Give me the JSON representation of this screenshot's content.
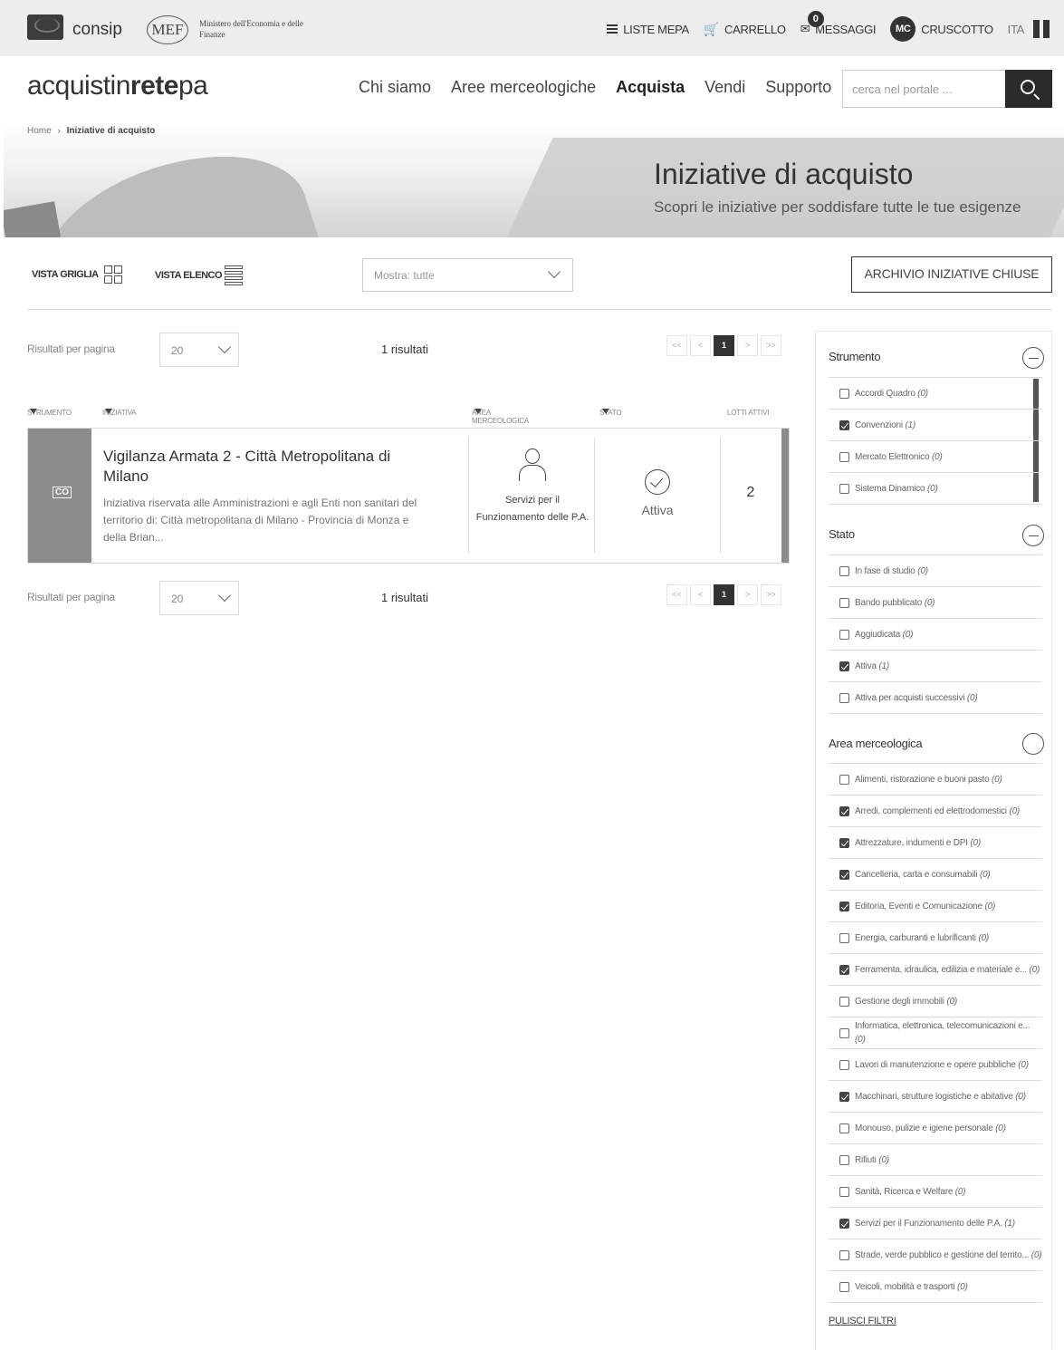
{
  "topbar": {
    "consip": "consip",
    "mef_logo": "MEF",
    "mef_text": "Ministero dell'Economia e delle Finanze",
    "liste_mepa": "LISTE MEPA",
    "carrello": "CARRELLO",
    "messaggi": "MESSAGGI",
    "messaggi_count": "0",
    "avatar": "MC",
    "cruscotto": "CRUSCOTTO",
    "lang": "ITA"
  },
  "header": {
    "brand_a": "acquistin",
    "brand_b": "rete",
    "brand_c": "pa",
    "nav": [
      "Chi siamo",
      "Aree merceologiche",
      "Acquista",
      "Vendi",
      "Supporto"
    ],
    "search_placeholder": "cerca nel portale ..."
  },
  "breadcrumb": {
    "home": "Home",
    "sep": "›",
    "current": "Iniziative di acquisto"
  },
  "hero": {
    "title": "Iniziative di acquisto",
    "subtitle": "Scopri le iniziative per soddisfare tutte le tue esigenze"
  },
  "toolbar": {
    "vista_griglia": "VISTA GRIGLIA",
    "vista_elenco": "VISTA ELENCO",
    "show_select": "Mostra: tutte",
    "archive": "ARCHIVIO INIZIATIVE CHIUSE"
  },
  "results": {
    "per_page_label": "Risultati per pagina",
    "per_page_value": "20",
    "count": "1 risultati",
    "pager": [
      "<<",
      "<",
      "1",
      ">",
      ">>"
    ]
  },
  "columns": {
    "strumento": "STRUMENTO",
    "iniziativa": "INIZIATIVA",
    "area": "AREA MERCEOLOGICA",
    "stato": "STATO",
    "lotti": "LOTTI ATTIVI"
  },
  "card": {
    "tag": "CO",
    "title": "Vigilanza Armata 2 - Città Metropolitana di Milano",
    "description": "Iniziativa riservata alle Amministrazioni e agli Enti non sanitari del territorio di: Città metropolitana di Milano - Provincia di Monza e della Brian...",
    "area": "Servizi per il Funzionamento delle P.A.",
    "status": "Attiva",
    "count": "2"
  },
  "filters": {
    "strumento": {
      "title": "Strumento",
      "options": [
        {
          "label": "Accordi Quadro",
          "count": "(0)",
          "checked": false
        },
        {
          "label": "Convenzioni",
          "count": "(1)",
          "checked": true
        },
        {
          "label": "Mercato Elettronico",
          "count": "(0)",
          "checked": false
        },
        {
          "label": "Sistema Dinamico",
          "count": "(0)",
          "checked": false
        }
      ]
    },
    "stato": {
      "title": "Stato",
      "options": [
        {
          "label": "In fase di studio",
          "count": "(0)",
          "checked": false
        },
        {
          "label": "Bando pubblicato",
          "count": "(0)",
          "checked": false
        },
        {
          "label": "Aggiudicata",
          "count": "(0)",
          "checked": false
        },
        {
          "label": "Attiva",
          "count": "(1)",
          "checked": true
        },
        {
          "label": "Attiva per acquisti successivi",
          "count": "(0)",
          "checked": false
        }
      ]
    },
    "area": {
      "title": "Area merceologica",
      "options": [
        {
          "label": "Alimenti, ristorazione e buoni pasto",
          "count": "(0)",
          "checked": false
        },
        {
          "label": "Arredi, complementi ed elettrodomestici",
          "count": "(0)",
          "checked": true
        },
        {
          "label": "Attrezzature, indumenti e DPI",
          "count": "(0)",
          "checked": true
        },
        {
          "label": "Cancelleria, carta e consumabili",
          "count": "(0)",
          "checked": true
        },
        {
          "label": "Editoria, Eventi e Comunicazione",
          "count": "(0)",
          "checked": true
        },
        {
          "label": "Energia, carburanti e lubrificanti",
          "count": "(0)",
          "checked": false
        },
        {
          "label": "Ferramenta, idraulica, edilizia e materiale e...",
          "count": "(0)",
          "checked": true
        },
        {
          "label": "Gestione degli immobili",
          "count": "(0)",
          "checked": false
        },
        {
          "label": "Informatica, elettronica, telecomunicazioni e...",
          "count": "(0)",
          "checked": false
        },
        {
          "label": "Lavori di manutenzione e opere pubbliche",
          "count": "(0)",
          "checked": false
        },
        {
          "label": "Macchinari, strutture logistiche e abitative",
          "count": "(0)",
          "checked": true
        },
        {
          "label": "Monouso, pulizie e igiene personale",
          "count": "(0)",
          "checked": false
        },
        {
          "label": "Rifiuti",
          "count": "(0)",
          "checked": false
        },
        {
          "label": "Sanità, Ricerca e Welfare",
          "count": "(0)",
          "checked": false
        },
        {
          "label": "Servizi per il Funzionamento delle P.A.",
          "count": "(1)",
          "checked": true
        },
        {
          "label": "Strade, verde pubblico e gestione del territo...",
          "count": "(0)",
          "checked": false
        },
        {
          "label": "Veicoli, mobilità e trasporti",
          "count": "(0)",
          "checked": false
        }
      ]
    },
    "clear": "PULISCI FILTRI"
  }
}
